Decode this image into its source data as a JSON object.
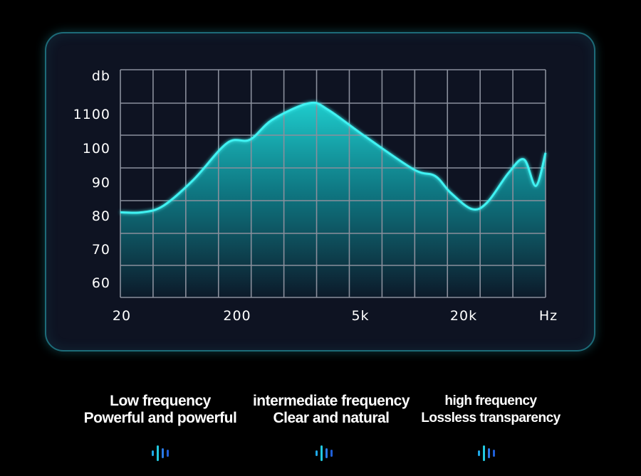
{
  "chart_data": {
    "type": "area",
    "title": "",
    "xlabel": "Hz",
    "ylabel": "db",
    "x_ticks": [
      "20",
      "200",
      "5k",
      "20k"
    ],
    "y_ticks": [
      "60",
      "70",
      "80",
      "90",
      "100",
      "1100"
    ],
    "ylim": [
      55,
      125
    ],
    "grid": true,
    "x_scale": "log",
    "x": [
      20,
      30,
      45,
      80,
      150,
      230,
      350,
      700,
      1000,
      2000,
      5000,
      7500,
      10000,
      15000,
      20000,
      30000,
      40000,
      50000,
      60000
    ],
    "values": [
      77,
      77,
      79,
      87,
      98,
      99,
      105,
      110,
      108,
      100,
      90,
      88,
      83,
      78,
      80,
      89,
      93,
      85,
      95
    ],
    "colors": {
      "line": "#41f2f2",
      "fill_top": "#12b8bd",
      "fill_bottom": "#0c1a2a",
      "grid": "#8a8f9c",
      "panel_border": "#1d6b78"
    }
  },
  "bands": [
    {
      "title": "Low frequency",
      "subtitle": "Powerful and powerful",
      "icon": "sound-wave-icon"
    },
    {
      "title": "intermediate frequency",
      "subtitle": "Clear and natural",
      "icon": "sound-wave-icon"
    },
    {
      "title": "high frequency",
      "subtitle": "Lossless transparency",
      "icon": "sound-wave-icon"
    }
  ]
}
